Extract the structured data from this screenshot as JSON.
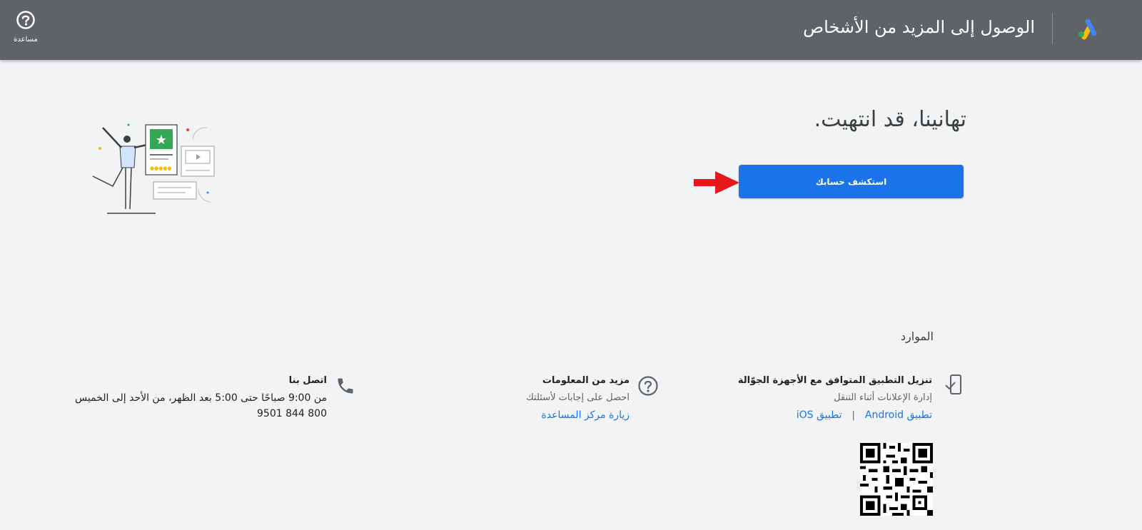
{
  "header": {
    "title": "الوصول إلى المزيد من الأشخاص",
    "help_label": "مساعدة",
    "logo_icon": "google-ads-logo"
  },
  "main": {
    "heading": "تهانينا، قد انتهيت.",
    "explore_button": "استكشف حسابك",
    "accent_color": "#1a73e8"
  },
  "resources": {
    "title": "الموارد",
    "mobile": {
      "icon": "mobile-icon",
      "title": "تنزيل التطبيق المتوافق مع الأجهزة الجوّالة",
      "desc": "إدارة الإعلانات أثناء التنقل",
      "android_link": "تطبيق Android",
      "separator": "|",
      "ios_link": "تطبيق iOS"
    },
    "info": {
      "icon": "help-circle-icon",
      "title": "مزيد من المعلومات",
      "desc": "احصل على إجابات لأسئلتك",
      "link": "زيارة مركز المساعدة"
    },
    "call": {
      "icon": "phone-icon",
      "title": "اتصل بنا",
      "hours": "من 9:00 صباحًا حتى 5:00 بعد الظهر، من الأحد إلى الخميس",
      "phone": "9501 844 800"
    }
  }
}
